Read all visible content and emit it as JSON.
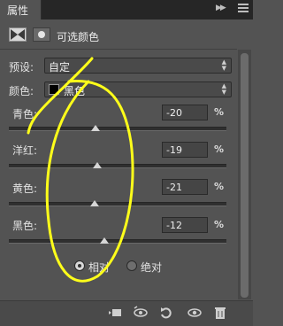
{
  "tab": {
    "label": "属性"
  },
  "header": {
    "title": "可选颜色"
  },
  "preset": {
    "label": "预设:",
    "value": "自定"
  },
  "colors": {
    "label": "颜色:",
    "value": "黑色",
    "swatch_color": "#000000"
  },
  "sliders": [
    {
      "label": "青色:",
      "value": "-20",
      "unit": "%",
      "level": -20
    },
    {
      "label": "洋红:",
      "value": "-19",
      "unit": "%",
      "level": -19
    },
    {
      "label": "黄色:",
      "value": "-21",
      "unit": "%",
      "level": -21
    },
    {
      "label": "黑色:",
      "value": "-12",
      "unit": "%",
      "level": -12
    }
  ],
  "method": {
    "relative": "相对",
    "absolute": "绝对",
    "selected": "relative"
  },
  "annotation_color": "#ffff1a",
  "icons": [
    "collapse-icon",
    "close-icon",
    "panel-menu-icon",
    "adjustment-icon",
    "mask-icon",
    "clip-to-layer-icon",
    "view-previous-icon",
    "reset-icon",
    "visibility-icon",
    "delete-icon"
  ]
}
